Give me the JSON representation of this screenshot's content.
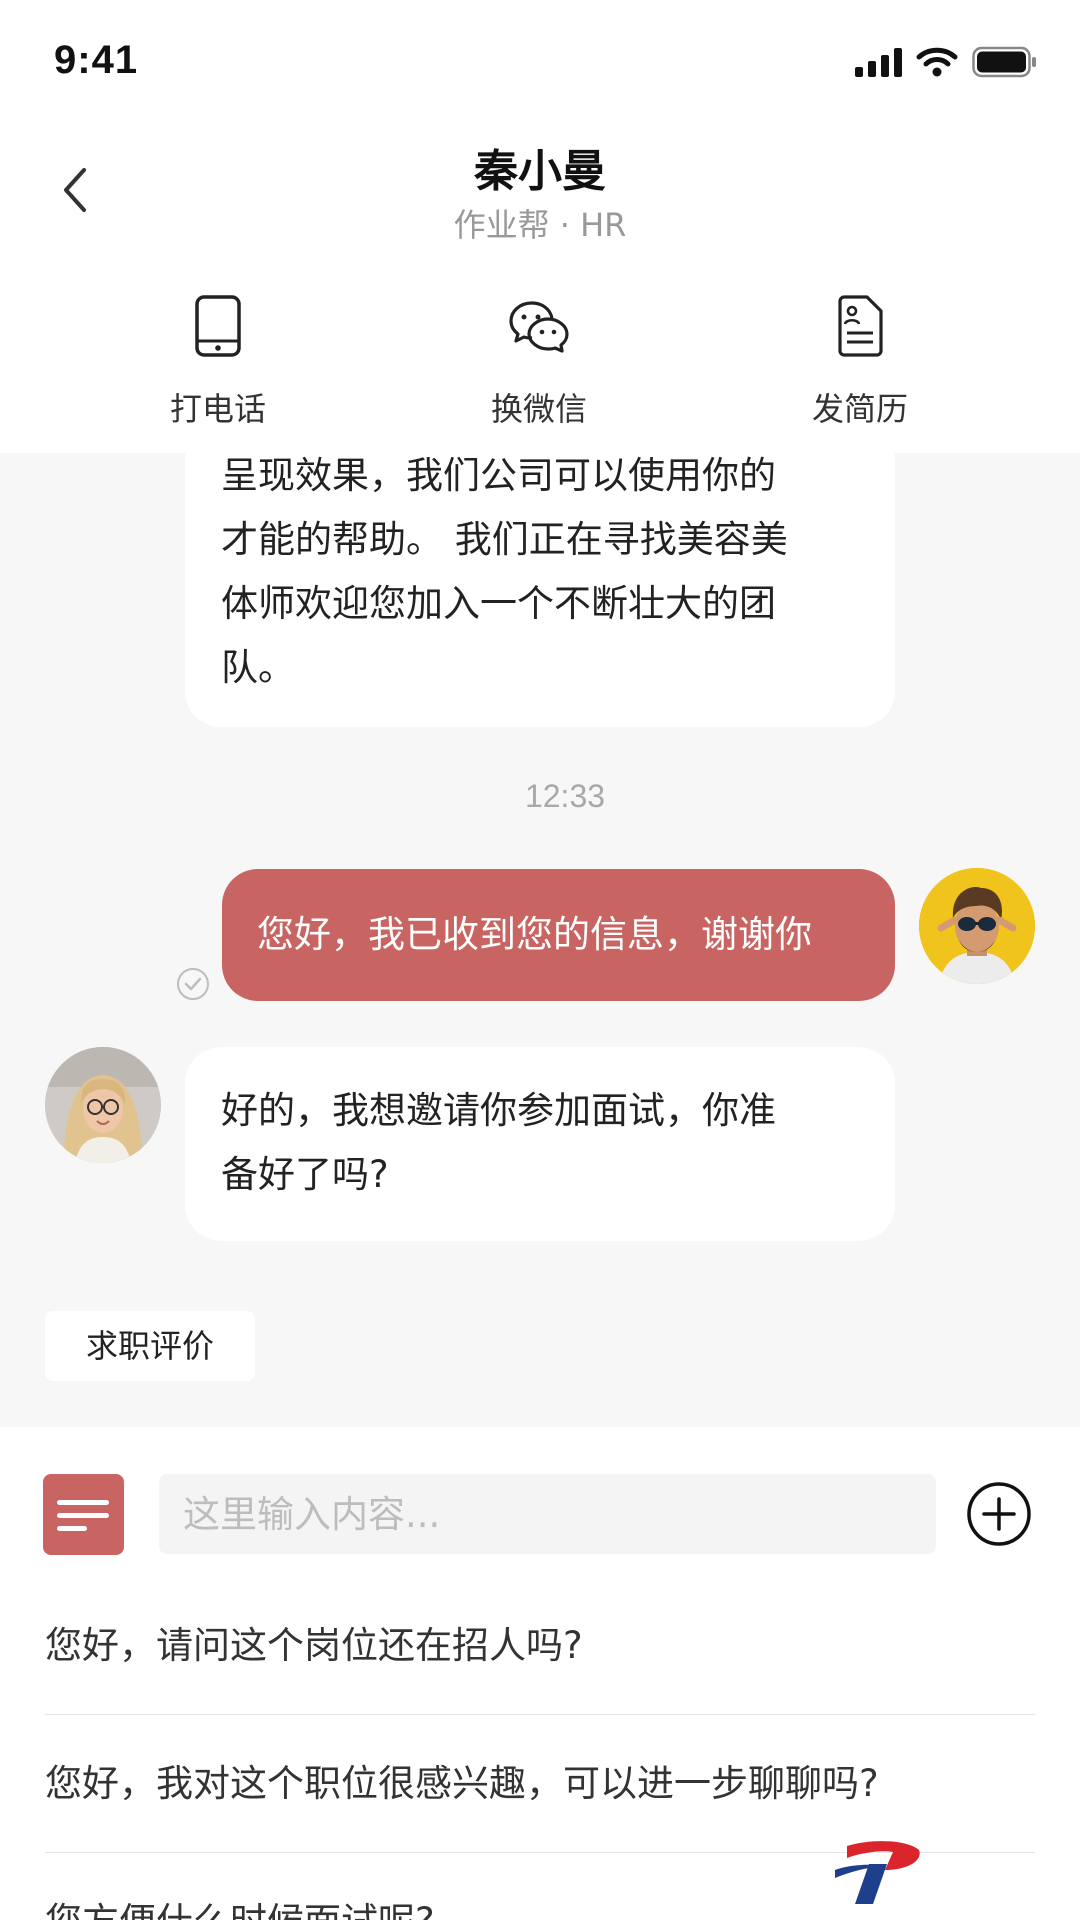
{
  "status_bar": {
    "time": "9:41",
    "icons": [
      "signal-icon",
      "wifi-icon",
      "battery-icon"
    ]
  },
  "header": {
    "title": "秦小曼",
    "subtitle": "作业帮 · HR",
    "back_icon": "chevron-left-icon"
  },
  "actions": [
    {
      "label": "打电话",
      "icon": "phone-icon"
    },
    {
      "label": "换微信",
      "icon": "wechat-icon"
    },
    {
      "label": "发简历",
      "icon": "resume-icon"
    }
  ],
  "messages": {
    "first_in_lines": [
      "呈现效果，我们公司可以使用你的",
      "才能的帮助。  我们正在寻找美容美",
      "体师欢迎您加入一个不断壮大的团",
      "队。"
    ],
    "time_divider": "12:33",
    "out_text": "您好，我已收到您的信息，谢谢你",
    "second_in_lines": [
      "好的，我想邀请你参加面试，你准",
      "备好了吗?"
    ]
  },
  "tag": {
    "label": "求职评价"
  },
  "composer": {
    "placeholder": "这里输入内容...",
    "menu_icon": "menu-icon",
    "plus_icon": "plus-circle-icon"
  },
  "quick_replies": [
    "您好，请问这个岗位还在招人吗?",
    "您好，我对这个职位很感兴趣，可以进一步聊聊吗?",
    "您方便什么时候面试呢?"
  ],
  "colors": {
    "accent": "#c86461",
    "background": "#f7f7f7",
    "bubble_in": "#ffffff",
    "muted_text": "#999999"
  }
}
